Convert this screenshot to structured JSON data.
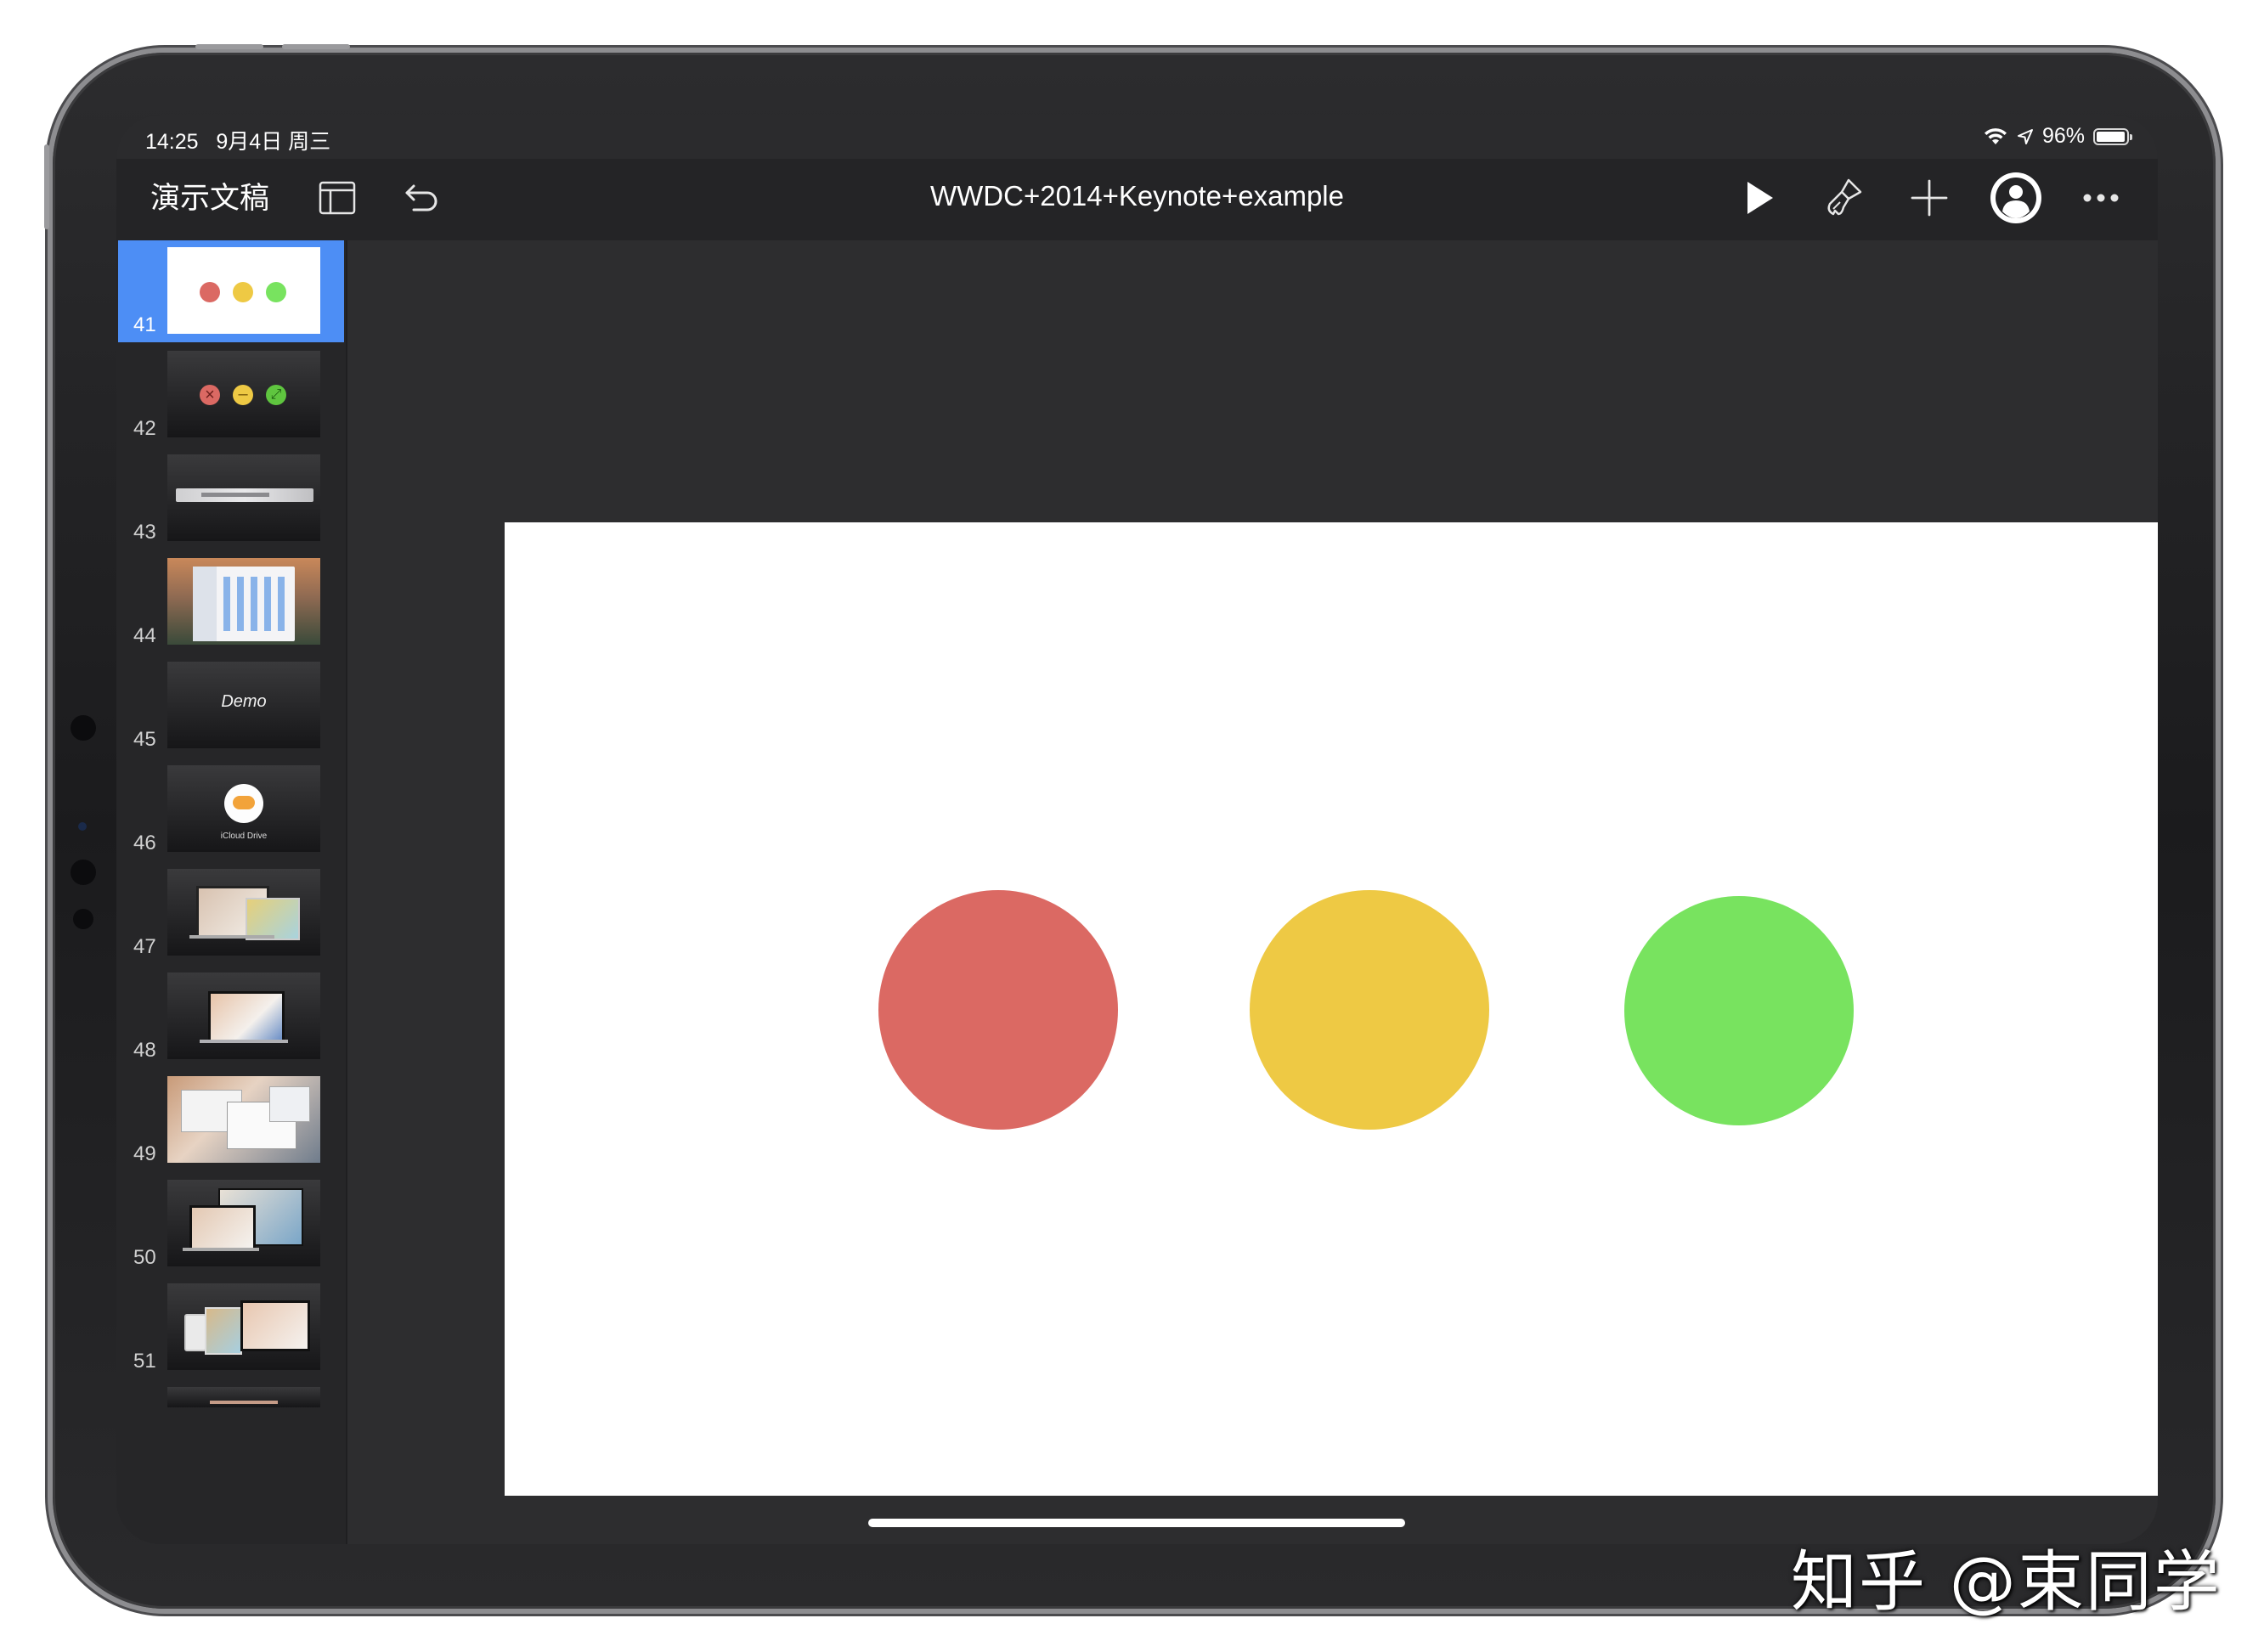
{
  "status_bar": {
    "time": "14:25",
    "date": "9月4日 周三",
    "battery_percent": "96%",
    "battery_level": 0.96,
    "icons": [
      "wifi-icon",
      "location-icon",
      "battery-icon"
    ]
  },
  "toolbar": {
    "documents_label": "演示文稿",
    "document_title": "WWDC+2014+Keynote+example",
    "icons": [
      "sidebar-toggle-icon",
      "undo-icon",
      "play-icon",
      "format-brush-icon",
      "plus-icon",
      "collaborate-icon",
      "more-icon"
    ]
  },
  "slides": [
    {
      "number": "41",
      "selected": true,
      "content": "three-dots-plain"
    },
    {
      "number": "42",
      "content": "window-buttons"
    },
    {
      "number": "43",
      "content": "toolbar-screenshot"
    },
    {
      "number": "44",
      "content": "finder-screenshot"
    },
    {
      "number": "45",
      "content": "title",
      "title": "Demo"
    },
    {
      "number": "46",
      "content": "icloud",
      "caption": "iCloud Drive"
    },
    {
      "number": "47",
      "content": "devices-screenshot"
    },
    {
      "number": "48",
      "content": "laptop-screenshot"
    },
    {
      "number": "49",
      "content": "desktop-screenshot"
    },
    {
      "number": "50",
      "content": "devices-screenshot"
    },
    {
      "number": "51",
      "content": "devices-screenshot"
    },
    {
      "number": "",
      "content": "partial"
    }
  ],
  "current_slide": {
    "circles": [
      {
        "name": "red-circle",
        "color": "#db6963"
      },
      {
        "name": "yellow-circle",
        "color": "#eec944"
      },
      {
        "name": "green-circle",
        "color": "#78e35f"
      }
    ]
  },
  "colors": {
    "accent_selected": "#4d8ef5",
    "toolbar_bg": "#242426",
    "canvas_bg": "#2d2d2f"
  },
  "watermark": "知乎 @束同学"
}
